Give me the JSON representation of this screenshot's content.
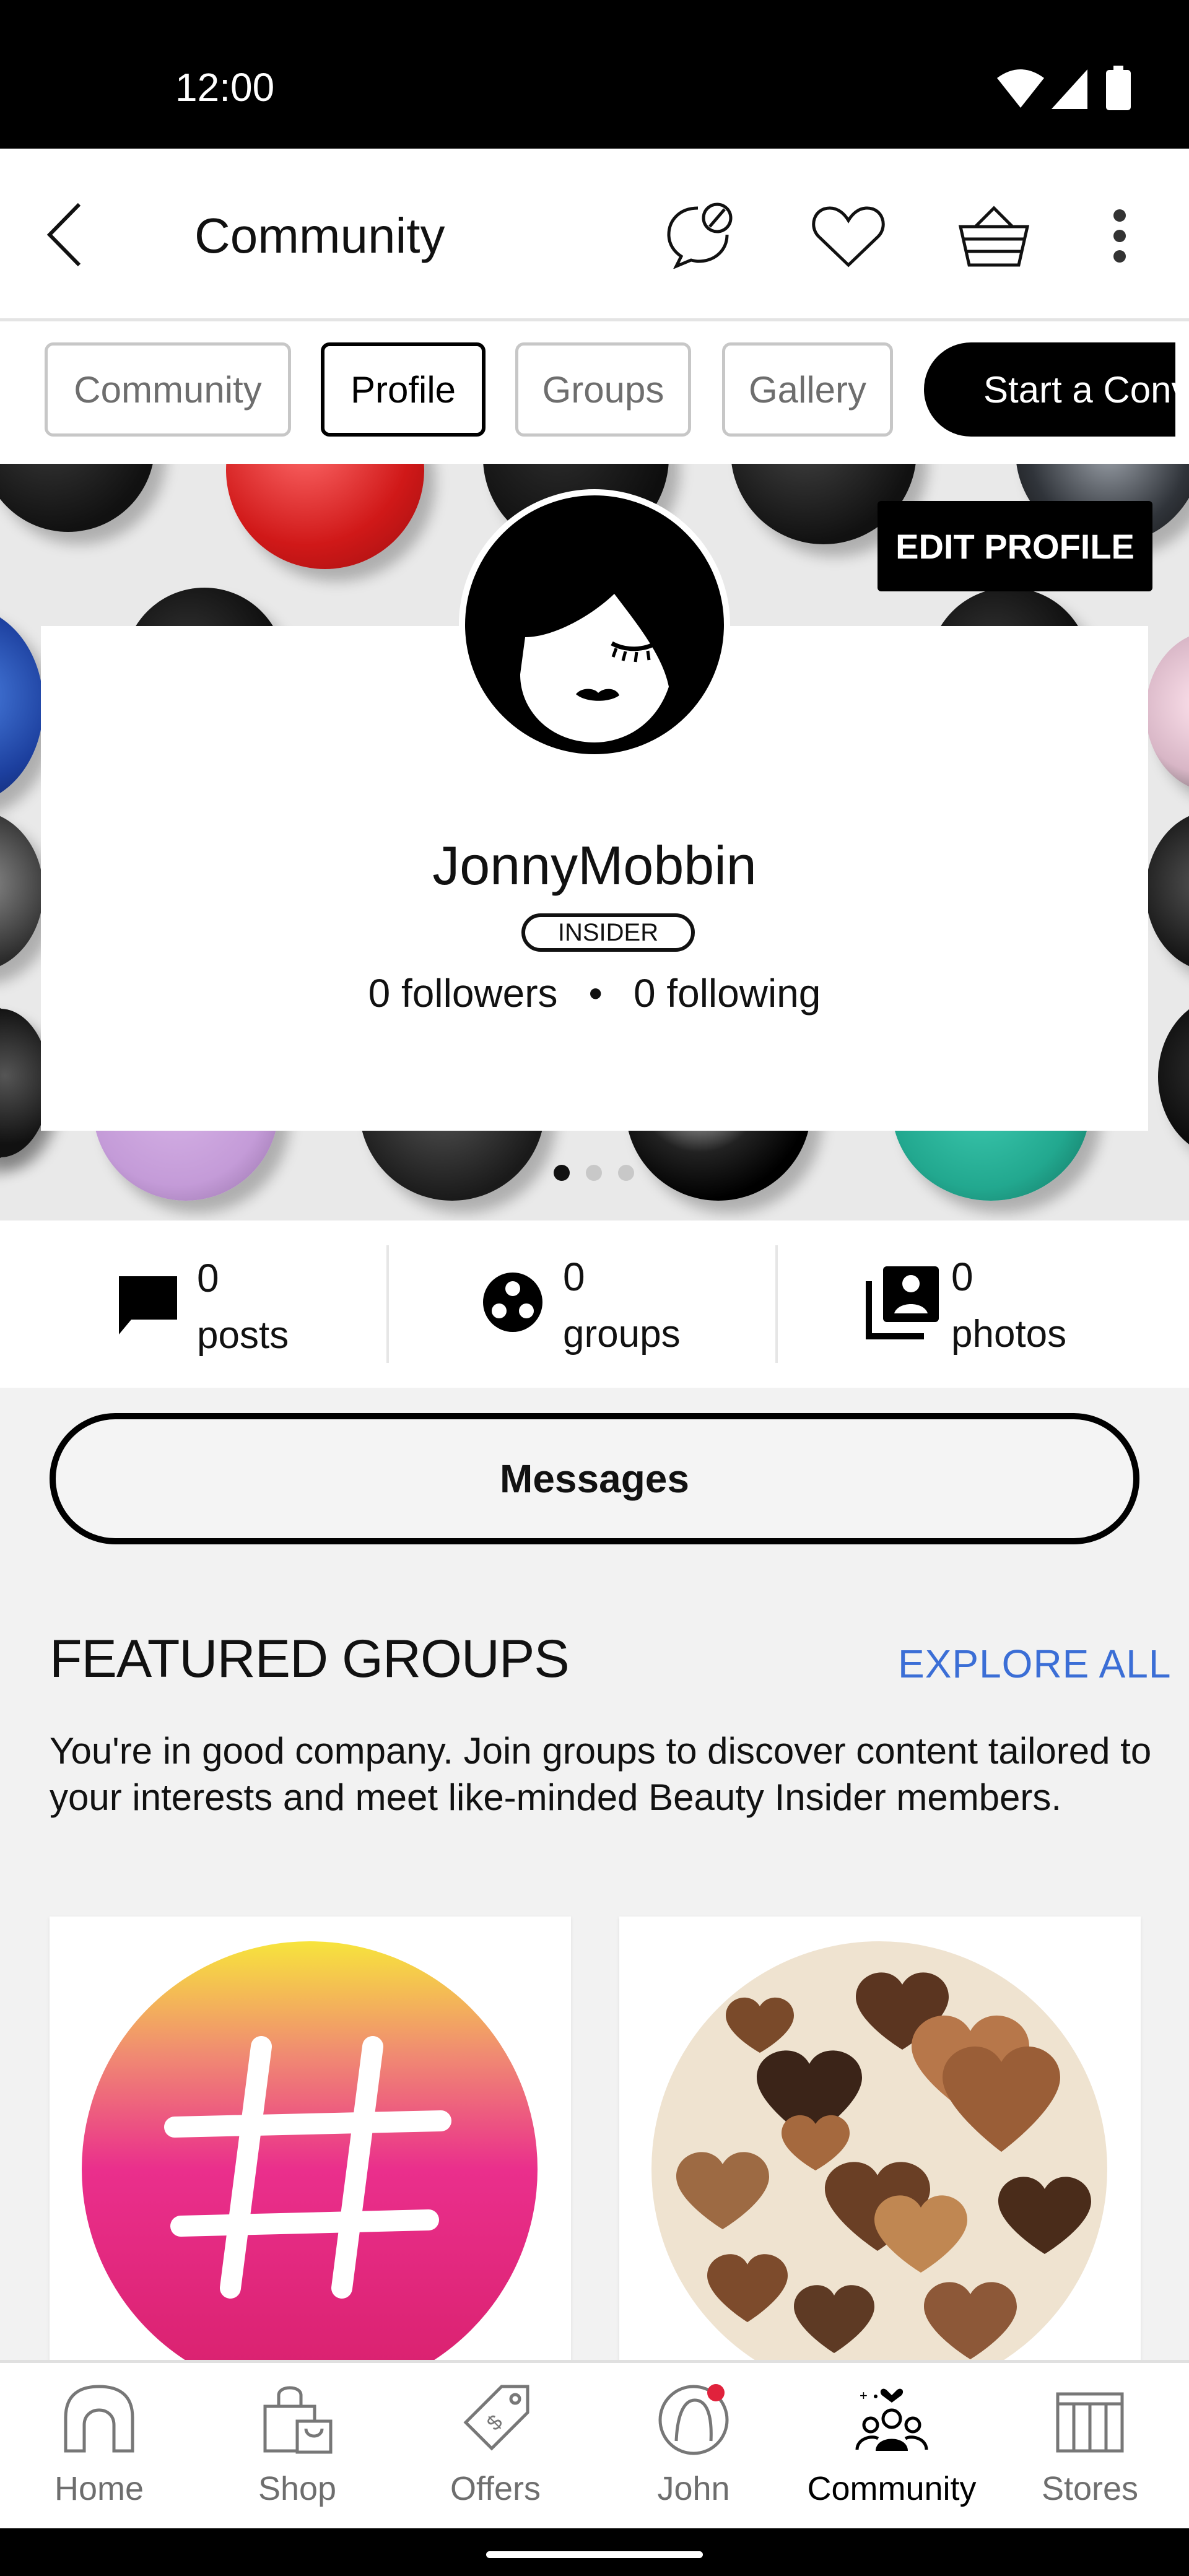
{
  "status_bar": {
    "time": "12:00"
  },
  "app_bar": {
    "title": "Community"
  },
  "chips": [
    {
      "label": "Community"
    },
    {
      "label": "Profile"
    },
    {
      "label": "Groups"
    },
    {
      "label": "Gallery"
    },
    {
      "label": "Start a Conv"
    }
  ],
  "profile": {
    "edit_label": "EDIT PROFILE",
    "username": "JonnyMobbin",
    "badge": "INSIDER",
    "followers": "0 followers",
    "separator": "•",
    "following": "0 following",
    "carousel_active_index": 0,
    "carousel_count": 3
  },
  "stats": [
    {
      "count": "0",
      "label": "posts",
      "icon": "chat-bubble-icon"
    },
    {
      "count": "0",
      "label": "groups",
      "icon": "groups-icon"
    },
    {
      "count": "0",
      "label": "photos",
      "icon": "photo-library-icon"
    }
  ],
  "messages_label": "Messages",
  "featured_groups": {
    "title": "FEATURED GROUPS",
    "explore_label": "EXPLORE ALL",
    "description": "You're in good company. Join groups to discover content tailored to your interests and meet like-minded Beauty Insider members."
  },
  "bottom_nav": [
    {
      "label": "Home",
      "icon": "home-icon"
    },
    {
      "label": "Shop",
      "icon": "shopping-bag-icon"
    },
    {
      "label": "Offers",
      "icon": "tag-icon"
    },
    {
      "label": "John",
      "icon": "profile-icon"
    },
    {
      "label": "Community",
      "icon": "community-icon",
      "active": true
    },
    {
      "label": "Stores",
      "icon": "store-icon"
    }
  ],
  "colors": {
    "accent_link": "#3b6ed6",
    "notification_dot": "#e0223c"
  }
}
